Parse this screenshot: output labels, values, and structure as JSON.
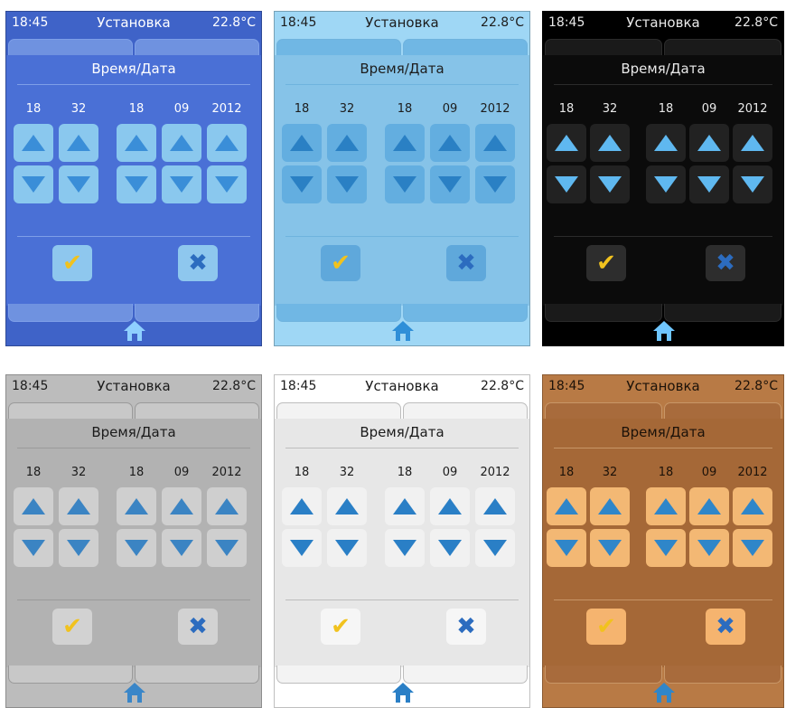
{
  "screens": [
    {
      "time": "18:45",
      "title": "Установка",
      "temp": "22.8°C",
      "section": "Время/Дата",
      "values": [
        "18",
        "32",
        "18",
        "09",
        "2012"
      ],
      "theme": {
        "bg": "#3f63c8",
        "band": "#4a70d6",
        "line": "#7e9fe8",
        "text": "#ffffff",
        "btn": "#8ac8ee",
        "arrow": "#3a8ed8",
        "tab": "#6f92e0",
        "check": "#f1c21e",
        "cross": "#2c6cbf",
        "action": "#8ec7ee",
        "home": "#8fd0ff"
      }
    },
    {
      "time": "18:45",
      "title": "Установка",
      "temp": "22.8°C",
      "section": "Время/Дата",
      "values": [
        "18",
        "32",
        "18",
        "09",
        "2012"
      ],
      "theme": {
        "bg": "#9fd7f5",
        "band": "#86c3e8",
        "line": "#6fb3de",
        "text": "#1d1d1d",
        "btn": "#63aee0",
        "arrow": "#2a80c4",
        "tab": "#70b7e4",
        "check": "#f1c21e",
        "cross": "#2c6cbf",
        "action": "#5fa8db",
        "home": "#2f8fd8"
      }
    },
    {
      "time": "18:45",
      "title": "Установка",
      "temp": "22.8°C",
      "section": "Время/Дата",
      "values": [
        "18",
        "32",
        "18",
        "09",
        "2012"
      ],
      "theme": {
        "bg": "#000000",
        "band": "#0b0b0b",
        "line": "#2b2b2b",
        "text": "#e9e9e9",
        "btn": "#222222",
        "arrow": "#5fb8f0",
        "tab": "#1a1a1a",
        "check": "#f1c21e",
        "cross": "#2c6cbf",
        "action": "#2d2d2d",
        "home": "#6fc6ff"
      }
    },
    {
      "time": "18:45",
      "title": "Установка",
      "temp": "22.8°C",
      "section": "Время/Дата",
      "values": [
        "18",
        "32",
        "18",
        "09",
        "2012"
      ],
      "theme": {
        "bg": "#bcbcbc",
        "band": "#b2b2b2",
        "line": "#9a9a9a",
        "text": "#1b1b1b",
        "btn": "#cfcfcf",
        "arrow": "#3b84c3",
        "tab": "#c8c8c8",
        "check": "#f1c21e",
        "cross": "#2c6cbf",
        "action": "#d2d2d2",
        "home": "#3a86c8"
      }
    },
    {
      "time": "18:45",
      "title": "Установка",
      "temp": "22.8°C",
      "section": "Время/Дата",
      "values": [
        "18",
        "32",
        "18",
        "09",
        "2012"
      ],
      "theme": {
        "bg": "#ffffff",
        "band": "#e7e7e7",
        "line": "#bdbdbd",
        "text": "#1b1b1b",
        "btn": "#f1f1f1",
        "arrow": "#2a7fc6",
        "tab": "#f3f3f3",
        "check": "#f1c21e",
        "cross": "#2c6cbf",
        "action": "#f6f6f6",
        "home": "#2a7fc6"
      }
    },
    {
      "time": "18:45",
      "title": "Установка",
      "temp": "22.8°C",
      "section": "Время/Дата",
      "values": [
        "18",
        "32",
        "18",
        "09",
        "2012"
      ],
      "theme": {
        "bg": "#b87a45",
        "band": "#a56837",
        "line": "#c89667",
        "text": "#1c1209",
        "btn": "#f3b874",
        "arrow": "#2f86c9",
        "tab": "#a86b3c",
        "check": "#f1c21e",
        "cross": "#2c6cbf",
        "action": "#f5b46f",
        "home": "#2f86c9"
      }
    }
  ]
}
